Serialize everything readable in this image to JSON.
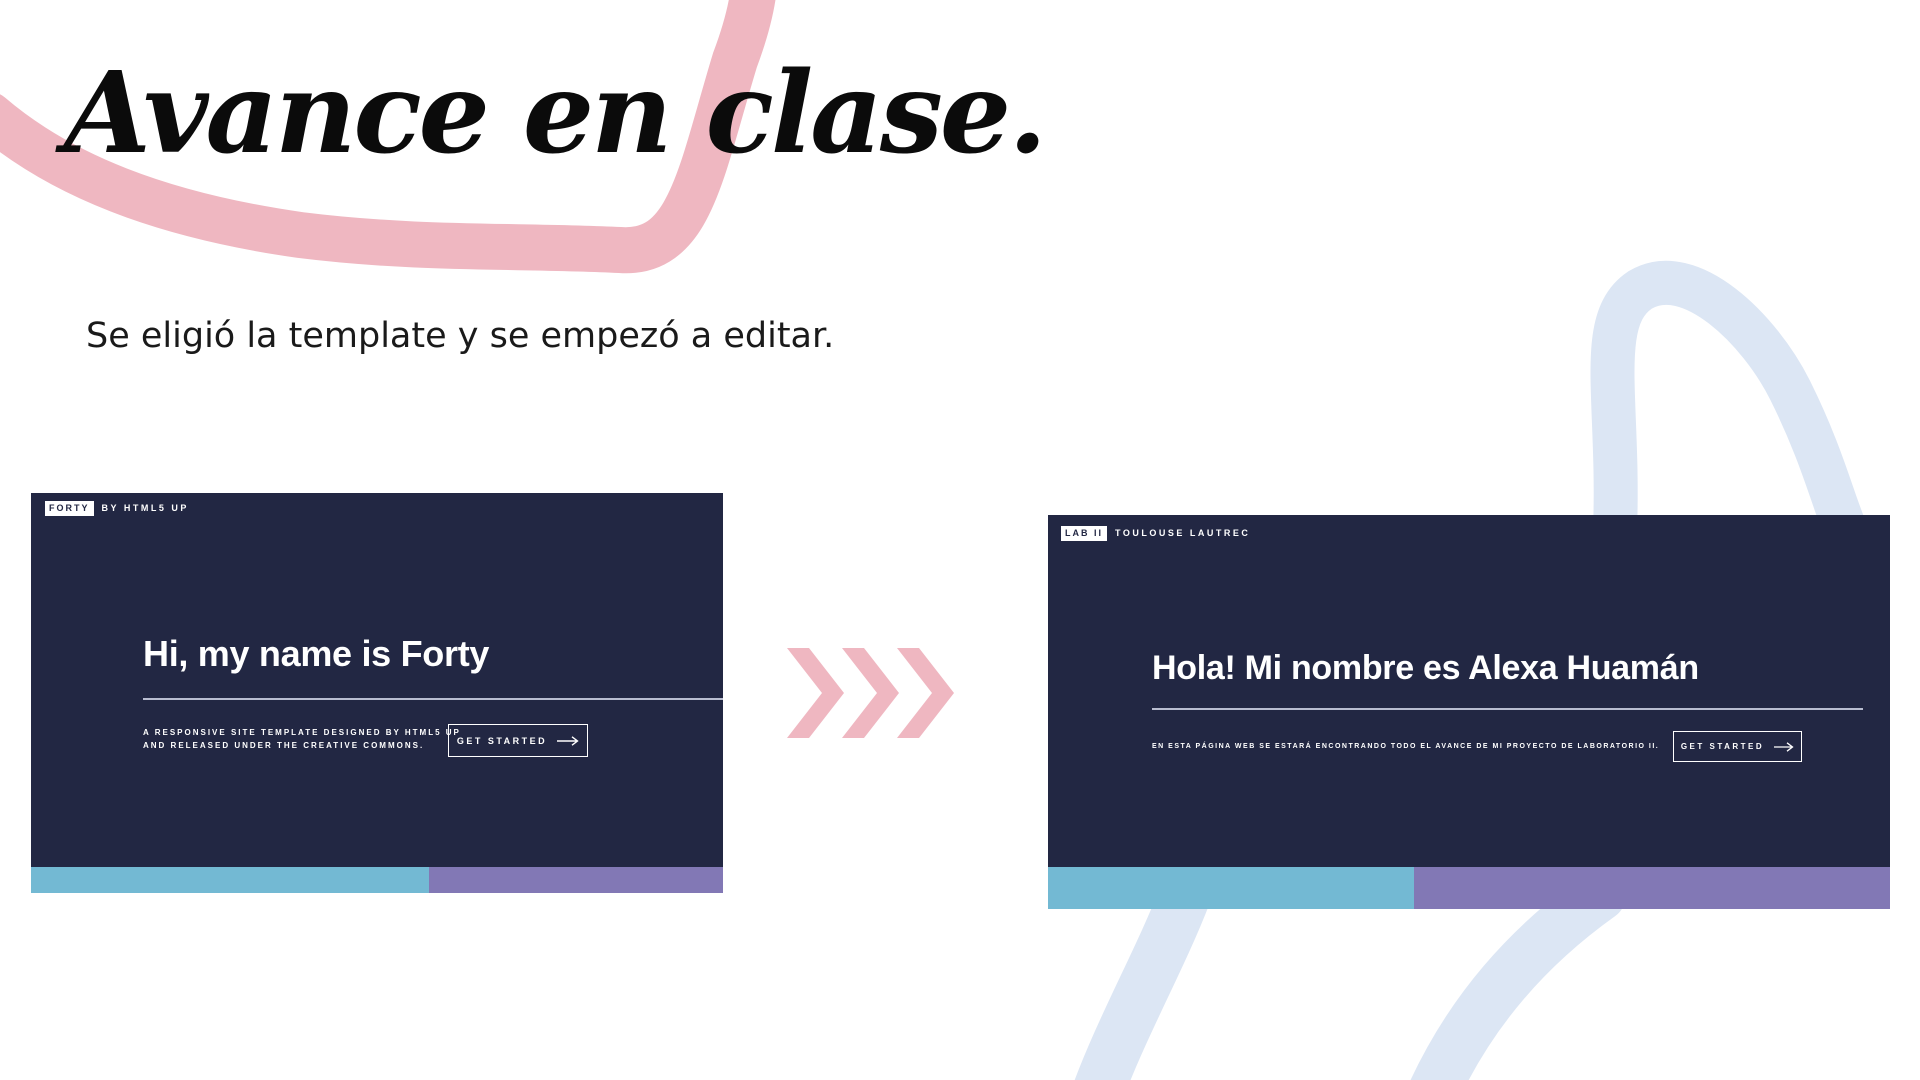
{
  "slide": {
    "title": "Avance en clase.",
    "subtitle": "Se eligió la template y se empezó a editar."
  },
  "colors": {
    "accent_pink": "#EFB7C1",
    "accent_blue": "#DCE6F4",
    "site_background": "#222743",
    "stripe_cyan": "#73B9D3",
    "stripe_purple": "#8278B5"
  },
  "original_site": {
    "brand_box": "FORTY",
    "brand_text": "BY HTML5 UP",
    "hero_title": "Hi, my name is Forty",
    "description_line1": "A responsive site template designed by HTML5 UP",
    "description_line2": "and released under the Creative Commons.",
    "cta_label": "GET STARTED",
    "stripes": [
      {
        "color": "#73B9D3",
        "fraction": 0.575
      },
      {
        "color": "#8278B5",
        "fraction": 0.425
      }
    ]
  },
  "arrow_icon": "triple-chevron-right-icon",
  "edited_site": {
    "brand_box": "LAB II",
    "brand_text": "TOULOUSE LAUTREC",
    "hero_title": "Hola! Mi nombre es Alexa Huamán",
    "description": "En esta página web se estará encontrando todo el avance de mi proyecto de laboratorio II.",
    "cta_label": "GET STARTED",
    "stripes": [
      {
        "color": "#73B9D3",
        "fraction": 0.435
      },
      {
        "color": "#8278B5",
        "fraction": 0.565
      }
    ]
  }
}
